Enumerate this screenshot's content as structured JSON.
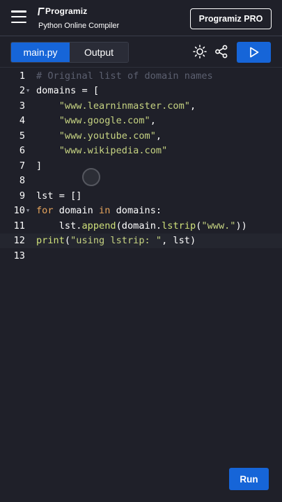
{
  "header": {
    "brand": "Programiz",
    "subtitle": "Python Online Compiler",
    "pro_button": "Programiz PRO"
  },
  "toolbar": {
    "tabs": [
      {
        "label": "main.py",
        "active": true
      },
      {
        "label": "Output",
        "active": false
      }
    ],
    "icons": [
      "sun-icon",
      "share-icon",
      "play-icon"
    ]
  },
  "editor": {
    "lines": [
      {
        "n": "1",
        "fold": false
      },
      {
        "n": "2",
        "fold": true
      },
      {
        "n": "3",
        "fold": false
      },
      {
        "n": "4",
        "fold": false
      },
      {
        "n": "5",
        "fold": false
      },
      {
        "n": "6",
        "fold": false
      },
      {
        "n": "7",
        "fold": false
      },
      {
        "n": "8",
        "fold": false
      },
      {
        "n": "9",
        "fold": false
      },
      {
        "n": "10",
        "fold": true
      },
      {
        "n": "11",
        "fold": false
      },
      {
        "n": "12",
        "fold": false
      },
      {
        "n": "13",
        "fold": false
      }
    ],
    "code": {
      "l1": "# Original list of domain names",
      "l2_var": "domains",
      "l2_rest": " = [",
      "l3": "\"www.learninmaster.com\"",
      "l4": "\"www.google.com\"",
      "l5": "\"www.youtube.com\"",
      "l6": "\"www.wikipedia.com\"",
      "l7": "]",
      "l9": "lst = []",
      "l10_for": "for",
      "l10_a": " domain ",
      "l10_in": "in",
      "l10_b": " domains:",
      "l11_a": "lst.",
      "l11_fn": "append",
      "l11_b": "(domain.",
      "l11_fn2": "lstrip",
      "l11_c": "(",
      "l11_str": "\"www.\"",
      "l11_d": "))",
      "l12_fn": "print",
      "l12_a": "(",
      "l12_str": "\"using lstrip: \"",
      "l12_b": ", lst)"
    }
  },
  "run_button": "Run",
  "colors": {
    "accent": "#1665d8",
    "background": "#1f2029",
    "string": "#c6d382",
    "keyword": "#e6a45c",
    "comment": "#5c6070"
  }
}
